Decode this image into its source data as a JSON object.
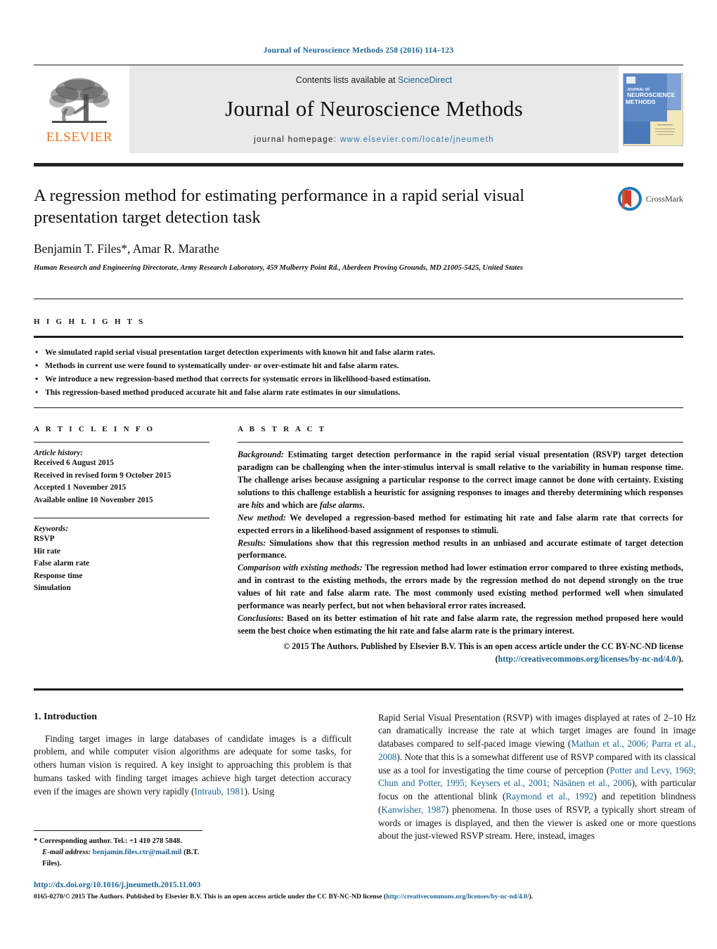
{
  "running_head": "Journal of Neuroscience Methods 258 (2016) 114–123",
  "masthead": {
    "publisher_logo_text": "ELSEVIER",
    "contents_prefix": "Contents lists available at ",
    "contents_link": "ScienceDirect",
    "journal_title": "Journal of Neuroscience Methods",
    "homepage_prefix": "journal homepage: ",
    "homepage_url": "www.elsevier.com/locate/jneumeth",
    "cover_line1": "JOURNAL OF",
    "cover_line2": "NEUROSCIENCE",
    "cover_line3": "METHODS"
  },
  "article": {
    "title": "A regression method for estimating performance in a rapid serial visual presentation target detection task",
    "authors": "Benjamin T. Files*, Amar R. Marathe",
    "affiliation": "Human Research and Engineering Directorate, Army Research Laboratory, 459 Mulberry Point Rd., Aberdeen Proving Grounds, MD 21005-5425, United States",
    "crossmark_label": "CrossMark"
  },
  "highlights": {
    "heading": "H I G H L I G H T S",
    "items": [
      "We simulated rapid serial visual presentation target detection experiments with known hit and false alarm rates.",
      "Methods in current use were found to systematically under- or over-estimate hit and false alarm rates.",
      "We introduce a new regression-based method that corrects for systematic errors in likelihood-based estimation.",
      "This regression-based method produced accurate hit and false alarm rate estimates in our simulations."
    ]
  },
  "article_info": {
    "heading": "A R T I C L E    I N F O",
    "history_label": "Article history:",
    "history": [
      "Received 6 August 2015",
      "Received in revised form 9 October 2015",
      "Accepted 1 November 2015",
      "Available online 10 November 2015"
    ],
    "keywords_label": "Keywords:",
    "keywords": [
      "RSVP",
      "Hit rate",
      "False alarm rate",
      "Response time",
      "Simulation"
    ]
  },
  "abstract": {
    "heading": "A B S T R A C T",
    "background_label": "Background:",
    "background_text": " Estimating target detection performance in the rapid serial visual presentation (RSVP) target detection paradigm can be challenging when the inter-stimulus interval is small relative to the variability in human response time. The challenge arises because assigning a particular response to the correct image cannot be done with certainty. Existing solutions to this challenge establish a heuristic for assigning responses to images and thereby determining which responses are ",
    "background_hits": "hits",
    "background_mid": " and which are ",
    "background_fa": "false alarms",
    "background_end": ".",
    "newmethod_label": "New method:",
    "newmethod_text": " We developed a regression-based method for estimating hit rate and false alarm rate that corrects for expected errors in a likelihood-based assignment of responses to stimuli.",
    "results_label": "Results:",
    "results_text": " Simulations show that this regression method results in an unbiased and accurate estimate of target detection performance.",
    "comparison_label": "Comparison with existing methods:",
    "comparison_text": " The regression method had lower estimation error compared to three existing methods, and in contrast to the existing methods, the errors made by the regression method do not depend strongly on the true values of hit rate and false alarm rate. The most commonly used existing method performed well when simulated performance was nearly perfect, but not when behavioral error rates increased.",
    "conclusions_label": "Conclusions:",
    "conclusions_text": " Based on its better estimation of hit rate and false alarm rate, the regression method proposed here would seem the best choice when estimating the hit rate and false alarm rate is the primary interest.",
    "copyright_text": "© 2015 The Authors. Published by Elsevier B.V. This is an open access article under the CC BY-NC-ND license (",
    "copyright_link": "http://creativecommons.org/licenses/by-nc-nd/4.0/",
    "copyright_end": ")."
  },
  "body": {
    "section_number_title": "1.  Introduction",
    "left_para_1": "Finding target images in large databases of candidate images is a difficult problem, and while computer vision algorithms are adequate for some tasks, for others human vision is required. A key insight to approaching this problem is that humans tasked with finding target images achieve high target detection accuracy even if the images are shown very rapidly (",
    "left_cite_1": "Intraub, 1981",
    "left_para_1_end": "). Using",
    "right_para_a": "Rapid Serial Visual Presentation (RSVP) with images displayed at rates of 2–10 Hz can dramatically increase the rate at which target images are found in image databases compared to self-paced image viewing (",
    "right_cite_1": "Mathan et al., 2006; Parra et al., 2008",
    "right_para_b": "). Note that this is a somewhat different use of RSVP compared with its classical use as a tool for investigating the time course of perception (",
    "right_cite_2": "Potter and Levy, 1969; Chun and Potter, 1995; Keysers et al., 2001; Näsänen et al., 2006",
    "right_para_c": "), with particular focus on the attentional blink (",
    "right_cite_3": "Raymond et al., 1992",
    "right_para_d": ") and repetition blindness (",
    "right_cite_4": "Kanwisher, 1987",
    "right_para_e": ") phenomena. In those uses of RSVP, a typically short stream of words or images is displayed, and then the viewer is asked one or more questions about the just-viewed RSVP stream. Here, instead, images"
  },
  "footnote": {
    "corresponding": "* Corresponding author. Tel.: +1 410 278 5848.",
    "email_label": "E-mail address:",
    "email": "benjamin.files.ctr@mail.mil",
    "email_suffix": " (B.T. Files)."
  },
  "page_footer": {
    "doi": "http://dx.doi.org/10.1016/j.jneumeth.2015.11.003",
    "issn_text": "0165-0270/© 2015 The Authors. Published by Elsevier B.V. This is an open access article under the CC BY-NC-ND license (",
    "issn_link": "http://creativecommons.org/licenses/by-nc-nd/4.0/",
    "issn_end": ")."
  },
  "colors": {
    "link_blue": "#1a6496",
    "elsevier_orange": "#E87722",
    "masthead_gray": "#e9e9e9",
    "rule_dark": "#1a1a1a",
    "cover_blue": "#5b87c5",
    "cover_cream": "#f2e8b8",
    "crossmark_blue": "#1f7bb6",
    "crossmark_red": "#cf3b22"
  }
}
